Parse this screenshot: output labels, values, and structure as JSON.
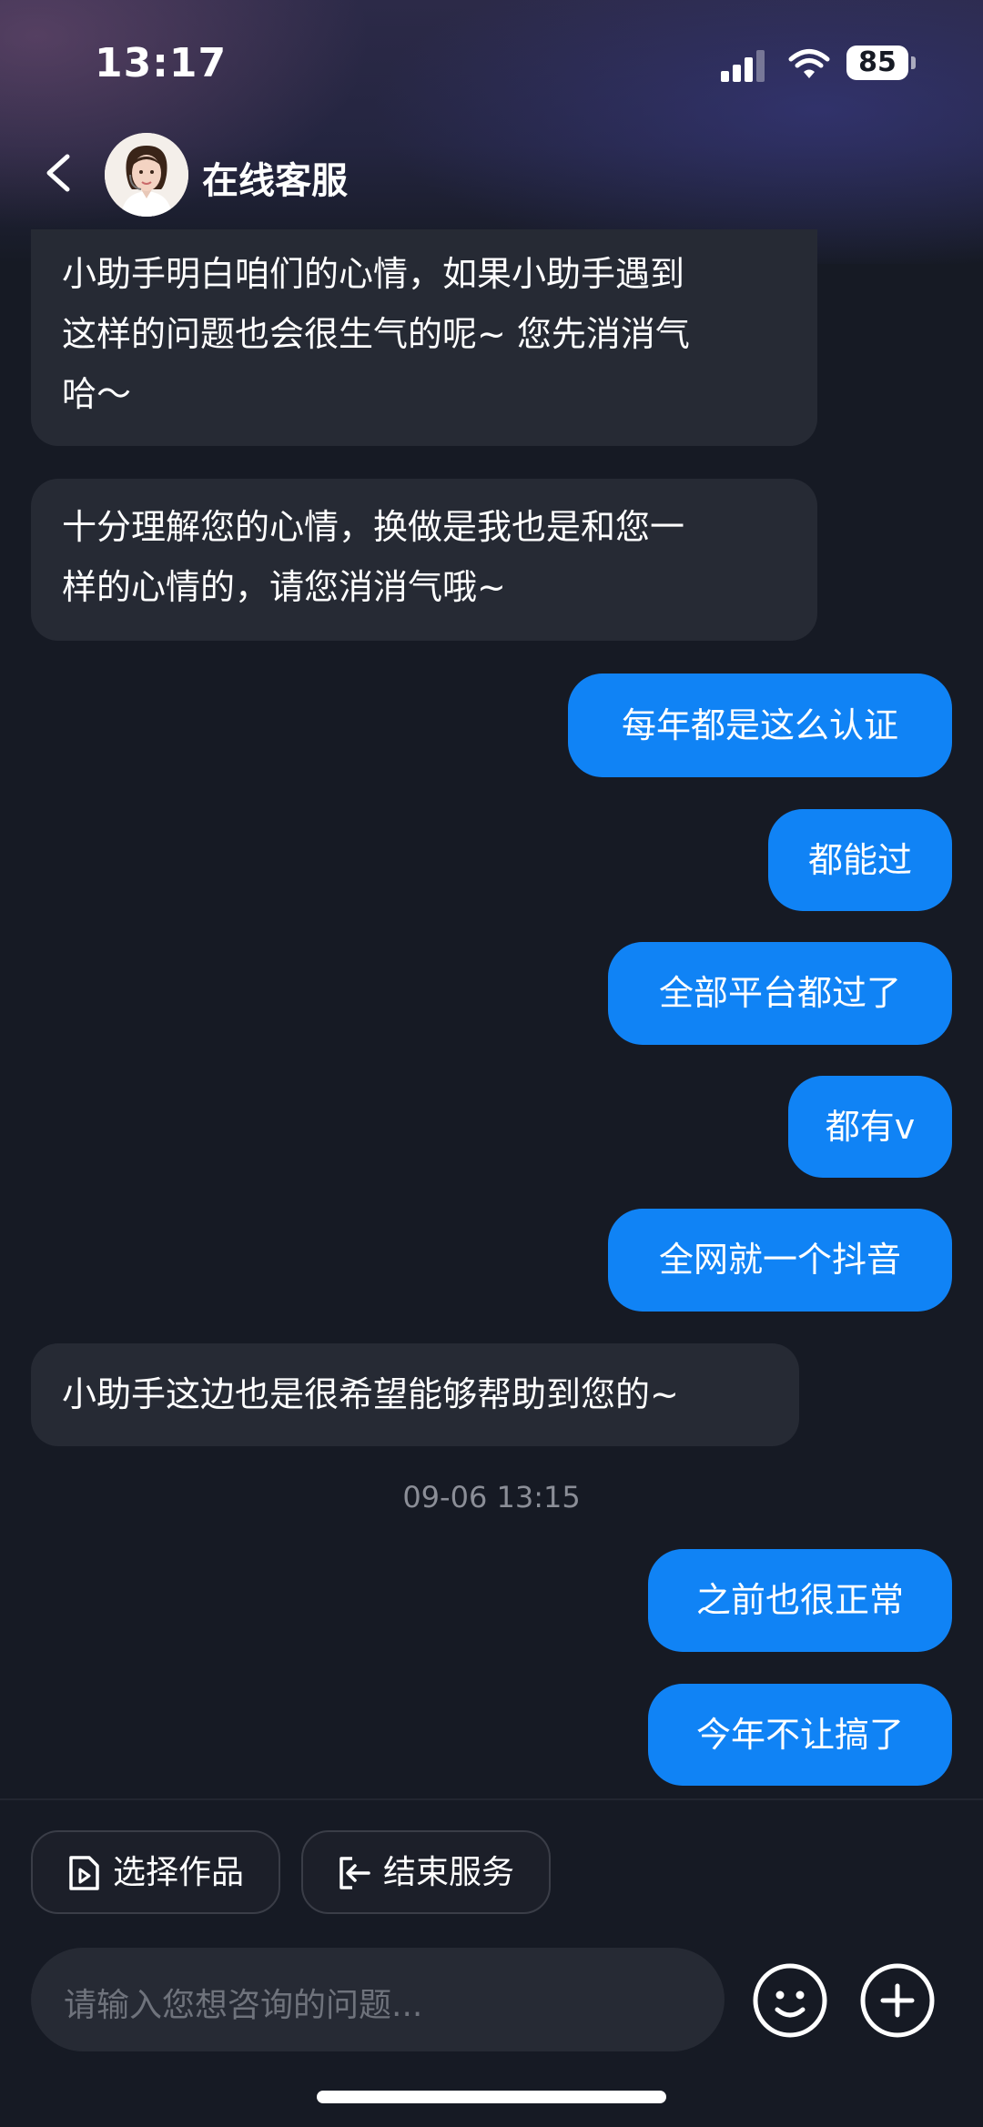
{
  "status_bar": {
    "time": "13:17",
    "battery": "85",
    "icons": [
      "signal-icon",
      "wifi-icon",
      "battery-icon"
    ]
  },
  "header": {
    "title": "在线客服",
    "back_icon": "chevron-left-icon",
    "avatar": "agent-avatar"
  },
  "messages": [
    {
      "side": "in",
      "lines": [
        "小助手明白咱们的心情，如果小助手遇到",
        "这样的问题也会很生气的呢~ 您先消消气",
        "哈～"
      ]
    },
    {
      "side": "in",
      "lines": [
        "十分理解您的心情，换做是我也是和您一",
        "样的心情的，请您消消气哦~"
      ]
    },
    {
      "side": "out",
      "text": "每年都是这么认证"
    },
    {
      "side": "out",
      "text": "都能过"
    },
    {
      "side": "out",
      "text": "全部平台都过了"
    },
    {
      "side": "out",
      "text": "都有v"
    },
    {
      "side": "out",
      "text": "全网就一个抖音"
    },
    {
      "side": "in",
      "lines": [
        "小助手这边也是很希望能够帮助到您的~"
      ]
    },
    {
      "side": "out",
      "text": "之前也很正常"
    },
    {
      "side": "out",
      "text": "今年不让搞了"
    }
  ],
  "timestamp": "09-06 13:15",
  "quick_actions": [
    {
      "label": "选择作品",
      "icon": "document-play-icon"
    },
    {
      "label": "结束服务",
      "icon": "exit-icon"
    }
  ],
  "input": {
    "placeholder": "请输入您想咨询的问题..."
  },
  "colors": {
    "background": "#161a24",
    "incoming_bubble": "#262a34",
    "outgoing_bubble": "#1083f5",
    "timestamp": "#8b8e97"
  }
}
